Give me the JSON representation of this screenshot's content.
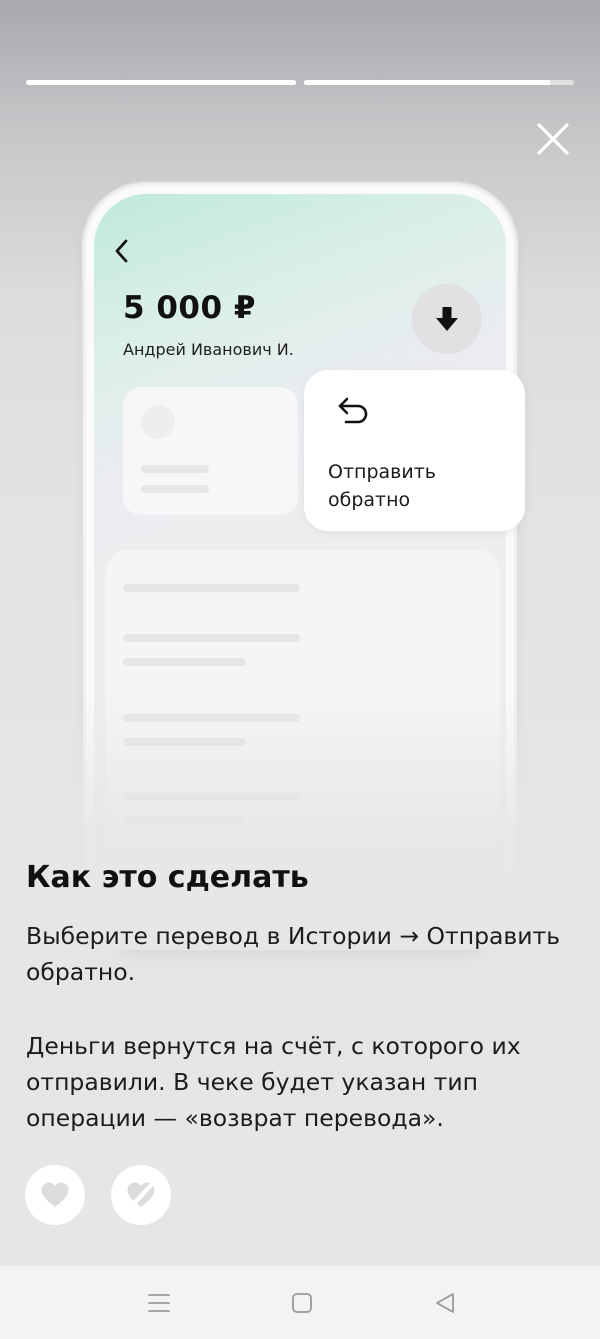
{
  "story": {
    "progress": [
      1.0,
      0.91
    ]
  },
  "phone": {
    "amount": "5 000 ₽",
    "payee": "Андрей Иванович И."
  },
  "popup": {
    "label": "Отправить обратно"
  },
  "content": {
    "title": "Как это сделать",
    "paragraph1": "Выберите перевод в Истории → Отправить обратно.",
    "paragraph2": "Деньги вернутся на счёт, с которого их отправили. В чеке будет указан тип операции — «возврат перевода»."
  },
  "icons": {
    "close": "close-icon",
    "back": "chevron-left-icon",
    "download": "arrow-down-icon",
    "return": "return-arrow-icon",
    "like": "heart-icon",
    "dislike": "heart-crossed-icon",
    "nav_menu": "menu-icon",
    "nav_home": "square-icon",
    "nav_back": "triangle-back-icon"
  },
  "colors": {
    "text": "#111111",
    "nav_background": "#f3f3f3",
    "button_background": "#ffffff"
  }
}
